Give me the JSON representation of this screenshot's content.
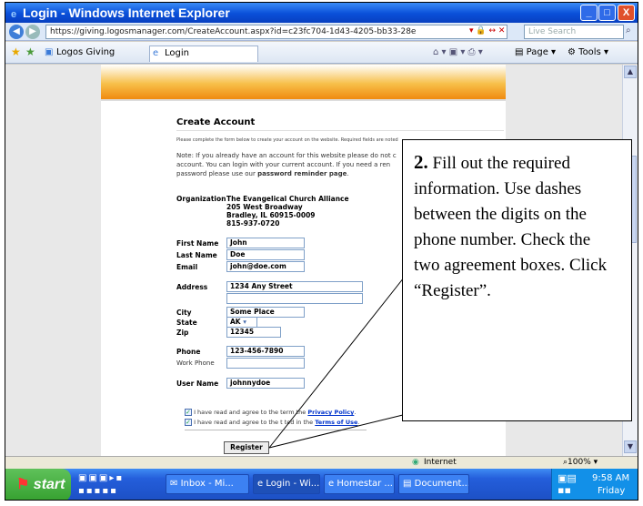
{
  "window": {
    "title": "Login - Windows Internet Explorer",
    "min": "_",
    "max": "□",
    "close": "X"
  },
  "nav": {
    "url": "https://giving.logosmanager.com/CreateAccount.aspx?id=c23fc704-1d43-4205-bb33-28e",
    "search_placeholder": "Live Search"
  },
  "tabs": [
    {
      "label": "Logos Giving"
    },
    {
      "label": "Login"
    }
  ],
  "toolbar": {
    "page": "Page",
    "tools": "Tools"
  },
  "form": {
    "heading": "Create Account",
    "intro": "Please complete the form below to create your account on the website. Required fields are noted",
    "note_line1": "Note: If you already have an account for this website please do not c",
    "note_line2": "account.  You can login with your current account.  If you need a ren",
    "note_line3_prefix": "password please use our",
    "note_link": "password reminder page",
    "org_label": "Organization",
    "org_name": "The Evangelical Church Alliance",
    "org_addr1": "205 West Broadway",
    "org_addr2": "Bradley, IL 60915-0009",
    "org_phone": "815-937-0720",
    "fields": {
      "first_name": {
        "label": "First Name",
        "value": "John"
      },
      "last_name": {
        "label": "Last Name",
        "value": "Doe"
      },
      "email": {
        "label": "Email",
        "value": "john@doe.com"
      },
      "address": {
        "label": "Address",
        "value": "1234 Any Street"
      },
      "city": {
        "label": "City",
        "value": "Some Place"
      },
      "state": {
        "label": "State",
        "value": "AK"
      },
      "zip": {
        "label": "Zip",
        "value": "12345"
      },
      "phone": {
        "label": "Phone",
        "value": "123-456-7890"
      },
      "work_phone": {
        "label": "Work Phone",
        "value": ""
      },
      "user_name": {
        "label": "User Name",
        "value": "johnnydoe"
      }
    },
    "agree1_prefix": "I have read and agree to the term",
    "agree1_mid": "the",
    "agree1_link": "Privacy Policy",
    "agree2_prefix": "I have read and agree to the t",
    "agree2_mid": "ted in the",
    "agree2_link": "Terms of Use",
    "register": "Register"
  },
  "callout": {
    "num": "2.",
    "text": "Fill out the required information.  Use dashes between the digits on the phone number.  Check the two agreement boxes. Click “Register”."
  },
  "status": {
    "zone": "Internet",
    "zoom": "100%"
  },
  "taskbar": {
    "start": "start",
    "buttons": [
      {
        "label": "Inbox - Mi..."
      },
      {
        "label": "Login - Wi..."
      },
      {
        "label": "Homestar ..."
      },
      {
        "label": "Document..."
      }
    ],
    "time": "9:58 AM",
    "day": "Friday"
  },
  "colors": {
    "accent": "#0a4fd9",
    "link": "#0033cc",
    "banner": "#f08a10",
    "taskbar": "#245edb"
  }
}
